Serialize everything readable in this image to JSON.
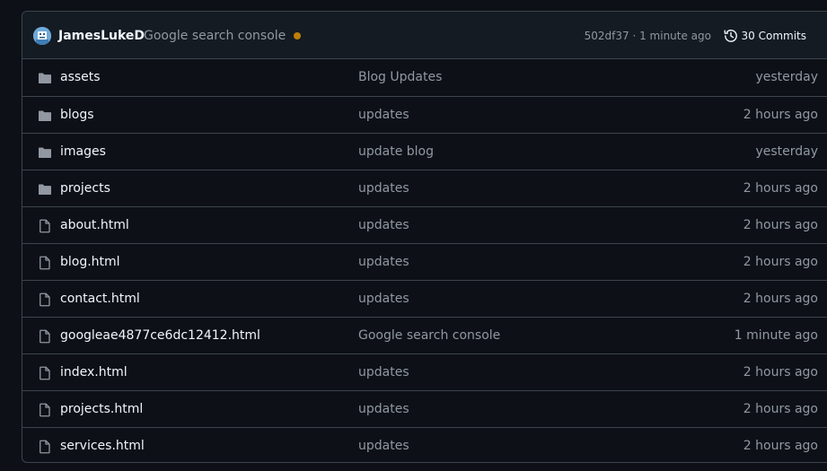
{
  "latest_commit": {
    "author": "JamesLukeD",
    "message": "Google search console",
    "status_color": "#bb8009",
    "meta": "502df37 · 1 minute ago",
    "commits_label": "30 Commits",
    "history_icon": "history-icon"
  },
  "files": [
    {
      "type": "folder",
      "icon": "folder-icon",
      "name": "assets",
      "message": "Blog Updates",
      "time": "yesterday"
    },
    {
      "type": "folder",
      "icon": "folder-icon",
      "name": "blogs",
      "message": "updates",
      "time": "2 hours ago"
    },
    {
      "type": "folder",
      "icon": "folder-icon",
      "name": "images",
      "message": "update blog",
      "time": "yesterday"
    },
    {
      "type": "folder",
      "icon": "folder-icon",
      "name": "projects",
      "message": "updates",
      "time": "2 hours ago"
    },
    {
      "type": "file",
      "icon": "file-icon",
      "name": "about.html",
      "message": "updates",
      "time": "2 hours ago"
    },
    {
      "type": "file",
      "icon": "file-icon",
      "name": "blog.html",
      "message": "updates",
      "time": "2 hours ago"
    },
    {
      "type": "file",
      "icon": "file-icon",
      "name": "contact.html",
      "message": "updates",
      "time": "2 hours ago"
    },
    {
      "type": "file",
      "icon": "file-icon",
      "name": "googleae4877ce6dc12412.html",
      "message": "Google search console",
      "time": "1 minute ago"
    },
    {
      "type": "file",
      "icon": "file-icon",
      "name": "index.html",
      "message": "updates",
      "time": "2 hours ago"
    },
    {
      "type": "file",
      "icon": "file-icon",
      "name": "projects.html",
      "message": "updates",
      "time": "2 hours ago"
    },
    {
      "type": "file",
      "icon": "file-icon",
      "name": "services.html",
      "message": "updates",
      "time": "2 hours ago"
    }
  ],
  "colors": {
    "background": "#0d1117",
    "header_background": "#151b23",
    "border": "#3d444d",
    "text_primary": "#f0f6fc",
    "text_muted": "#9198a1",
    "folder_icon": "#9198a1"
  }
}
